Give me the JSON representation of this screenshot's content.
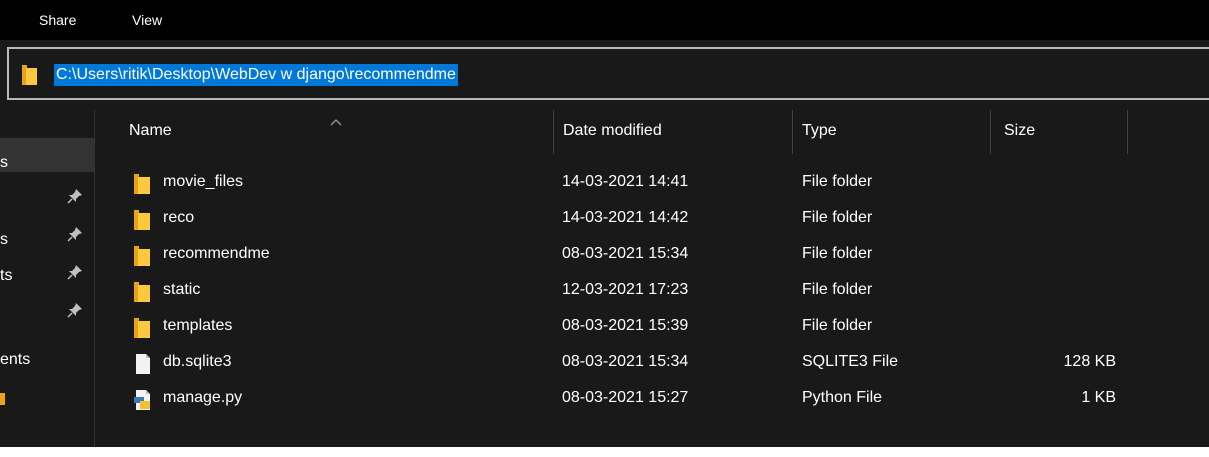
{
  "ribbon": {
    "tabs": [
      "Share",
      "View"
    ]
  },
  "address": {
    "path": "C:\\Users\\ritik\\Desktop\\WebDev w django\\recommendme"
  },
  "nav": {
    "items": [
      {
        "text": "s",
        "selected": true,
        "pinned": false
      },
      {
        "text": "",
        "selected": false,
        "pinned": true
      },
      {
        "text": "s",
        "selected": false,
        "pinned": true
      },
      {
        "text": "ts",
        "selected": false,
        "pinned": true
      },
      {
        "text": "",
        "selected": false,
        "pinned": true
      },
      {
        "text": "ents",
        "selected": false,
        "pinned": false
      }
    ]
  },
  "columns": {
    "name": "Name",
    "date": "Date modified",
    "type": "Type",
    "size": "Size"
  },
  "files": [
    {
      "name": "movie_files",
      "date": "14-03-2021 14:41",
      "type": "File folder",
      "size": "",
      "icon": "folder-icon"
    },
    {
      "name": "reco",
      "date": "14-03-2021 14:42",
      "type": "File folder",
      "size": "",
      "icon": "folder-icon"
    },
    {
      "name": "recommendme",
      "date": "08-03-2021 15:34",
      "type": "File folder",
      "size": "",
      "icon": "folder-icon"
    },
    {
      "name": "static",
      "date": "12-03-2021 17:23",
      "type": "File folder",
      "size": "",
      "icon": "folder-icon"
    },
    {
      "name": "templates",
      "date": "08-03-2021 15:39",
      "type": "File folder",
      "size": "",
      "icon": "folder-icon"
    },
    {
      "name": "db.sqlite3",
      "date": "08-03-2021 15:34",
      "type": "SQLITE3 File",
      "size": "128 KB",
      "icon": "document-icon"
    },
    {
      "name": "manage.py",
      "date": "08-03-2021 15:27",
      "type": "Python File",
      "size": "1 KB",
      "icon": "python-file-icon"
    }
  ],
  "colors": {
    "background": "#191919",
    "ribbon": "#000000",
    "selection": "#0078d7",
    "folder": "#ffc83d"
  }
}
